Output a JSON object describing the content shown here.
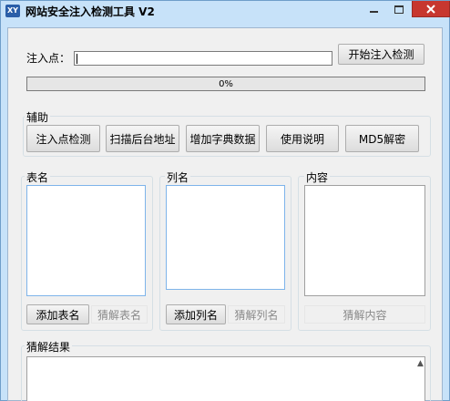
{
  "window": {
    "logo": "XY",
    "title": "网站安全注入检测工具 V2",
    "controls": {
      "minimize": "minimize-icon",
      "maximize": "maximize-icon",
      "close": "close-icon"
    }
  },
  "inject": {
    "label": "注入点：",
    "value": "",
    "start_button": "开始注入检测",
    "progress_text": "0%",
    "progress_value": 0
  },
  "assist": {
    "title": "辅助",
    "buttons": [
      "注入点检测",
      "扫描后台地址",
      "增加字典数据",
      "使用说明",
      "MD5解密"
    ]
  },
  "tables": {
    "title": "表名",
    "add_button": "添加表名",
    "crack_button": "猜解表名"
  },
  "columns": {
    "title": "列名",
    "add_button": "添加列名",
    "crack_button": "猜解列名"
  },
  "content": {
    "title": "内容",
    "crack_button": "猜解内容"
  },
  "result": {
    "title": "猜解结果"
  }
}
